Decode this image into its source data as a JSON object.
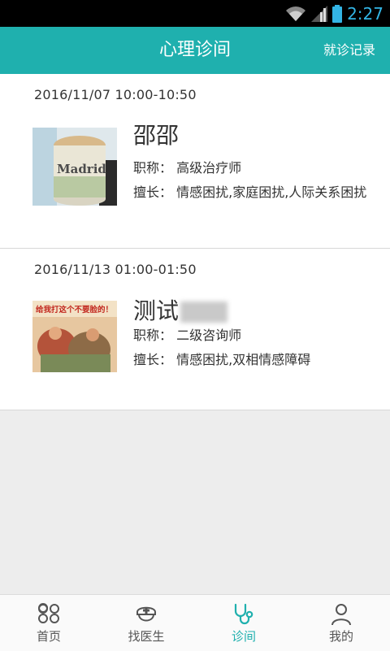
{
  "status_bar": {
    "time": "2:27"
  },
  "header": {
    "title": "心理诊间",
    "action": "就诊记录"
  },
  "appointments": [
    {
      "datetime": "2016/11/07  10:00-10:50",
      "name": "邵邵",
      "title_label": "职称：",
      "title_value": "高级治疗师",
      "skill_label": "擅长：",
      "skill_value": "情感困扰,家庭困扰,人际关系困扰",
      "photo_text": "Madrid"
    },
    {
      "datetime": "2016/11/13  01:00-01:50",
      "name": "测试",
      "title_label": "职称：",
      "title_value": "二级咨询师",
      "skill_label": "擅长：",
      "skill_value": "情感困扰,双相情感障碍",
      "photo_text": "给我打这个不要脸的！"
    }
  ],
  "tabs": [
    {
      "label": "首页",
      "icon": "home-grid-icon"
    },
    {
      "label": "找医生",
      "icon": "doctor-cap-icon"
    },
    {
      "label": "诊间",
      "icon": "stethoscope-icon",
      "active": true
    },
    {
      "label": "我的",
      "icon": "person-icon"
    }
  ],
  "colors": {
    "accent": "#1fb0ae",
    "status_time": "#33b5e5"
  }
}
